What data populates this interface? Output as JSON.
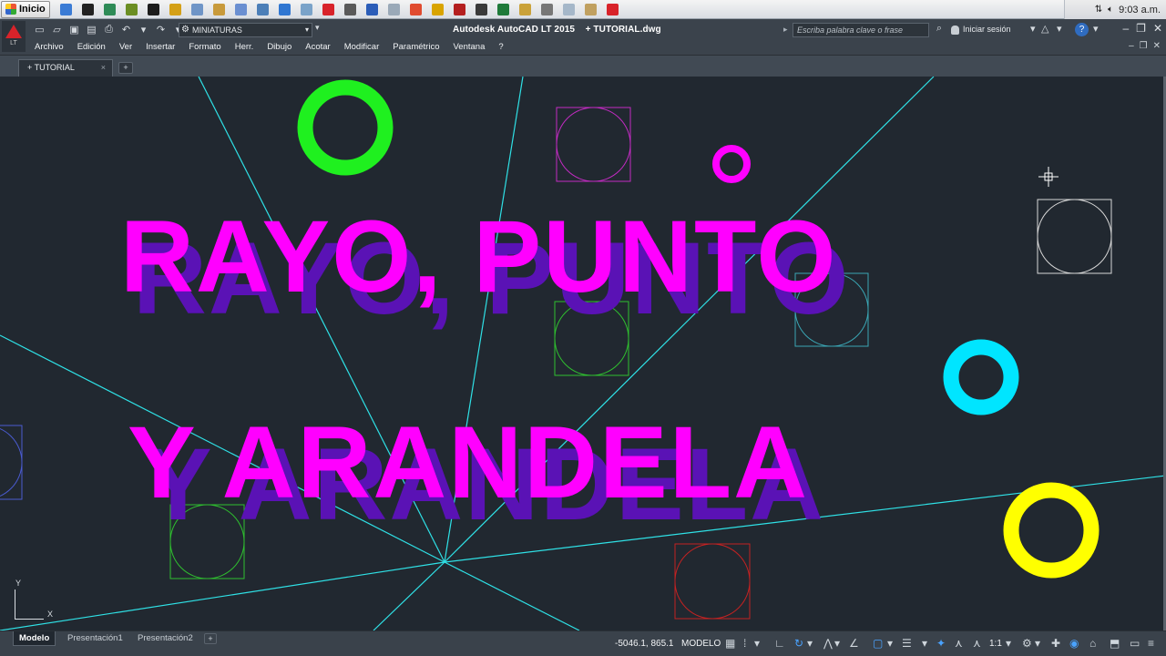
{
  "taskbar": {
    "start_label": "Inicio",
    "clock": "9:03 a.m.",
    "quick_launch_icons": [
      "ie-icon",
      "chrome-icon",
      "media-icon",
      "game-icon",
      "headset-icon",
      "paint-icon",
      "notes-icon",
      "folder-icon",
      "mail-icon",
      "network-icon",
      "globe-icon",
      "messenger-icon",
      "autocad-icon",
      "arrow-icon",
      "word-icon",
      "search-icon",
      "chrome-icon",
      "video-icon",
      "acrobat-icon",
      "console-icon",
      "excel-icon",
      "pencil-icon",
      "settings-icon",
      "document-icon",
      "image-icon",
      "autocad-icon"
    ],
    "quick_launch_colors": [
      "#3a7bd5",
      "#222222",
      "#2e8b57",
      "#6b8e23",
      "#1c1c1c",
      "#d4a017",
      "#6f95c7",
      "#c89a3b",
      "#6a8fd1",
      "#4c7fb8",
      "#2f76d1",
      "#7aa3c9",
      "#d8232a",
      "#5a5a5a",
      "#2b5db8",
      "#9aa9b8",
      "#e04b2f",
      "#d9a400",
      "#b41f1f",
      "#3a3a3a",
      "#1f7a3a",
      "#caa23a",
      "#777777",
      "#a5b7c9",
      "#c0a060",
      "#d8232a"
    ]
  },
  "titlebar": {
    "workspace": "MINIATURAS",
    "title_app": "Autodesk AutoCAD LT 2015",
    "title_file": "+ TUTORIAL.dwg",
    "search_placeholder": "Escriba palabra clave o frase",
    "signin": "Iniciar sesión",
    "app_logo_sub": "LT"
  },
  "menubar": {
    "items": [
      "Archivo",
      "Edición",
      "Ver",
      "Insertar",
      "Formato",
      "Herr.",
      "Dibujo",
      "Acotar",
      "Modificar",
      "Paramétrico",
      "Ventana",
      "?"
    ]
  },
  "tabs": {
    "document_tab": "+ TUTORIAL",
    "new_tab": "+"
  },
  "headline": {
    "line1": "RAYO, PUNTO",
    "line2": "Y ARANDELA",
    "fill_color": "#ff00ff",
    "shadow_color": "#5a12b5"
  },
  "drawing": {
    "ray_color": "#2fe1e6",
    "washers": [
      {
        "name": "green",
        "color": "#1ff01f"
      },
      {
        "name": "magenta-small",
        "color": "#ff00ff"
      },
      {
        "name": "cyan",
        "color": "#00e5ff"
      },
      {
        "name": "yellow",
        "color": "#ffff00"
      }
    ],
    "ucs": {
      "y": "Y",
      "x": "X"
    }
  },
  "layout_tabs": [
    "Modelo",
    "Presentación1",
    "Presentación2"
  ],
  "layout_add": "+",
  "statusbar": {
    "coords": "-5046.1, 865.1",
    "space": "MODELO",
    "scale": "1:1"
  }
}
